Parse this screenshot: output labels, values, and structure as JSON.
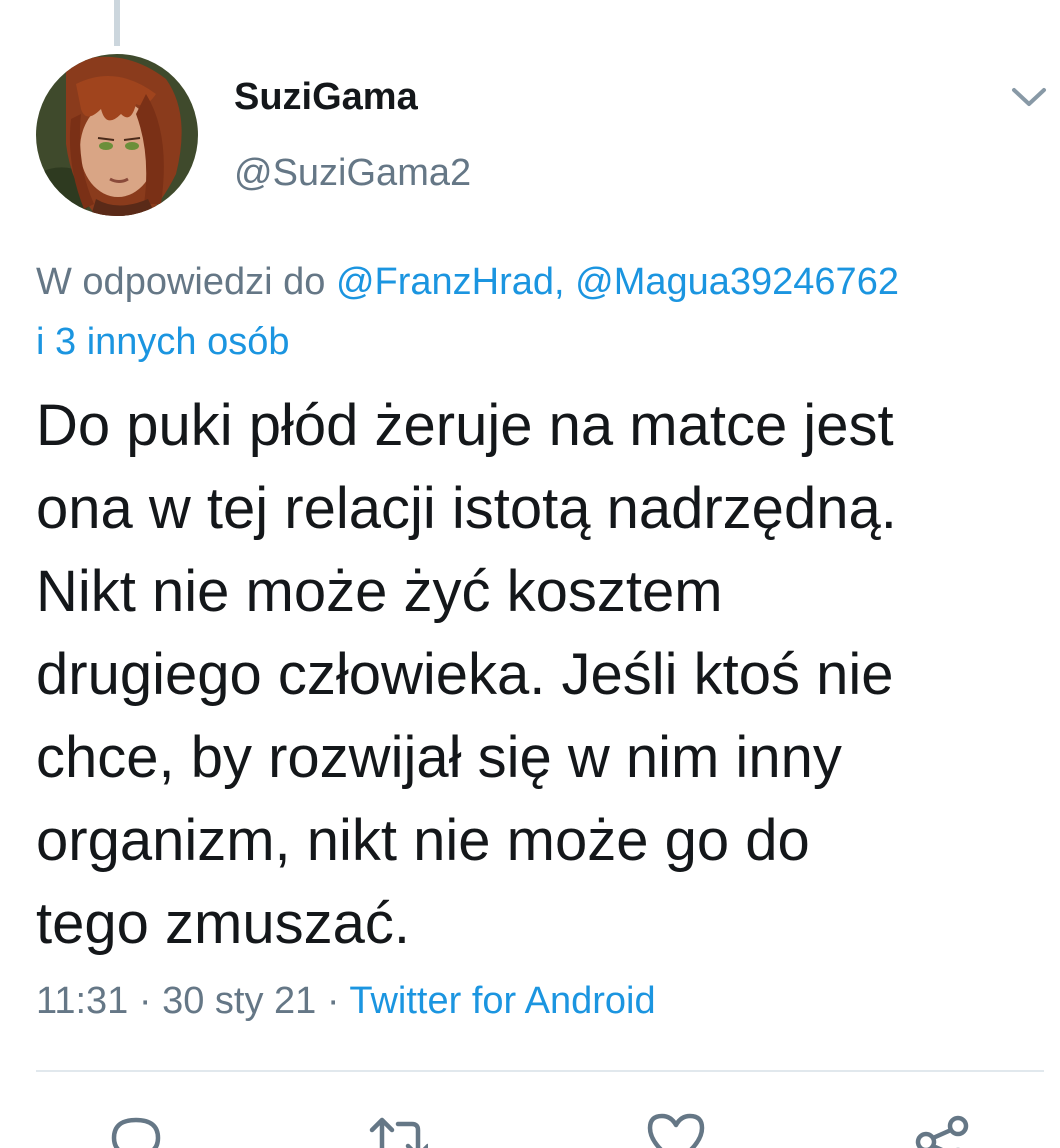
{
  "author": {
    "display_name": "SuziGama",
    "handle": "@SuziGama2",
    "avatar_icon": "profile-avatar-illustration"
  },
  "reply_context": {
    "prefix": "W odpowiedzi do ",
    "mentions": "@FranzHrad, @Magua39246762",
    "others": "i 3 innych osób"
  },
  "tweet": {
    "text": "Do puki płód żeruje na matce jest\nona w tej relacji istotą nadrzędną.\nNikt nie może żyć kosztem\ndrugiego człowieka. Jeśli ktoś nie\nchce, by rozwijał się w nim inny\norganizm, nikt nie może go do\ntego zmuszać."
  },
  "meta": {
    "time": "11:31",
    "separator": " · ",
    "date": "30 sty 21",
    "source": "Twitter for Android"
  },
  "actions": [
    {
      "name": "reply",
      "icon": "reply-icon"
    },
    {
      "name": "retweet",
      "icon": "retweet-icon"
    },
    {
      "name": "like",
      "icon": "heart-icon"
    },
    {
      "name": "share",
      "icon": "share-icon"
    }
  ],
  "colors": {
    "accent": "#1b95e0",
    "text_primary": "#14171a",
    "text_secondary": "#657786",
    "divider": "#e1e8ed"
  }
}
